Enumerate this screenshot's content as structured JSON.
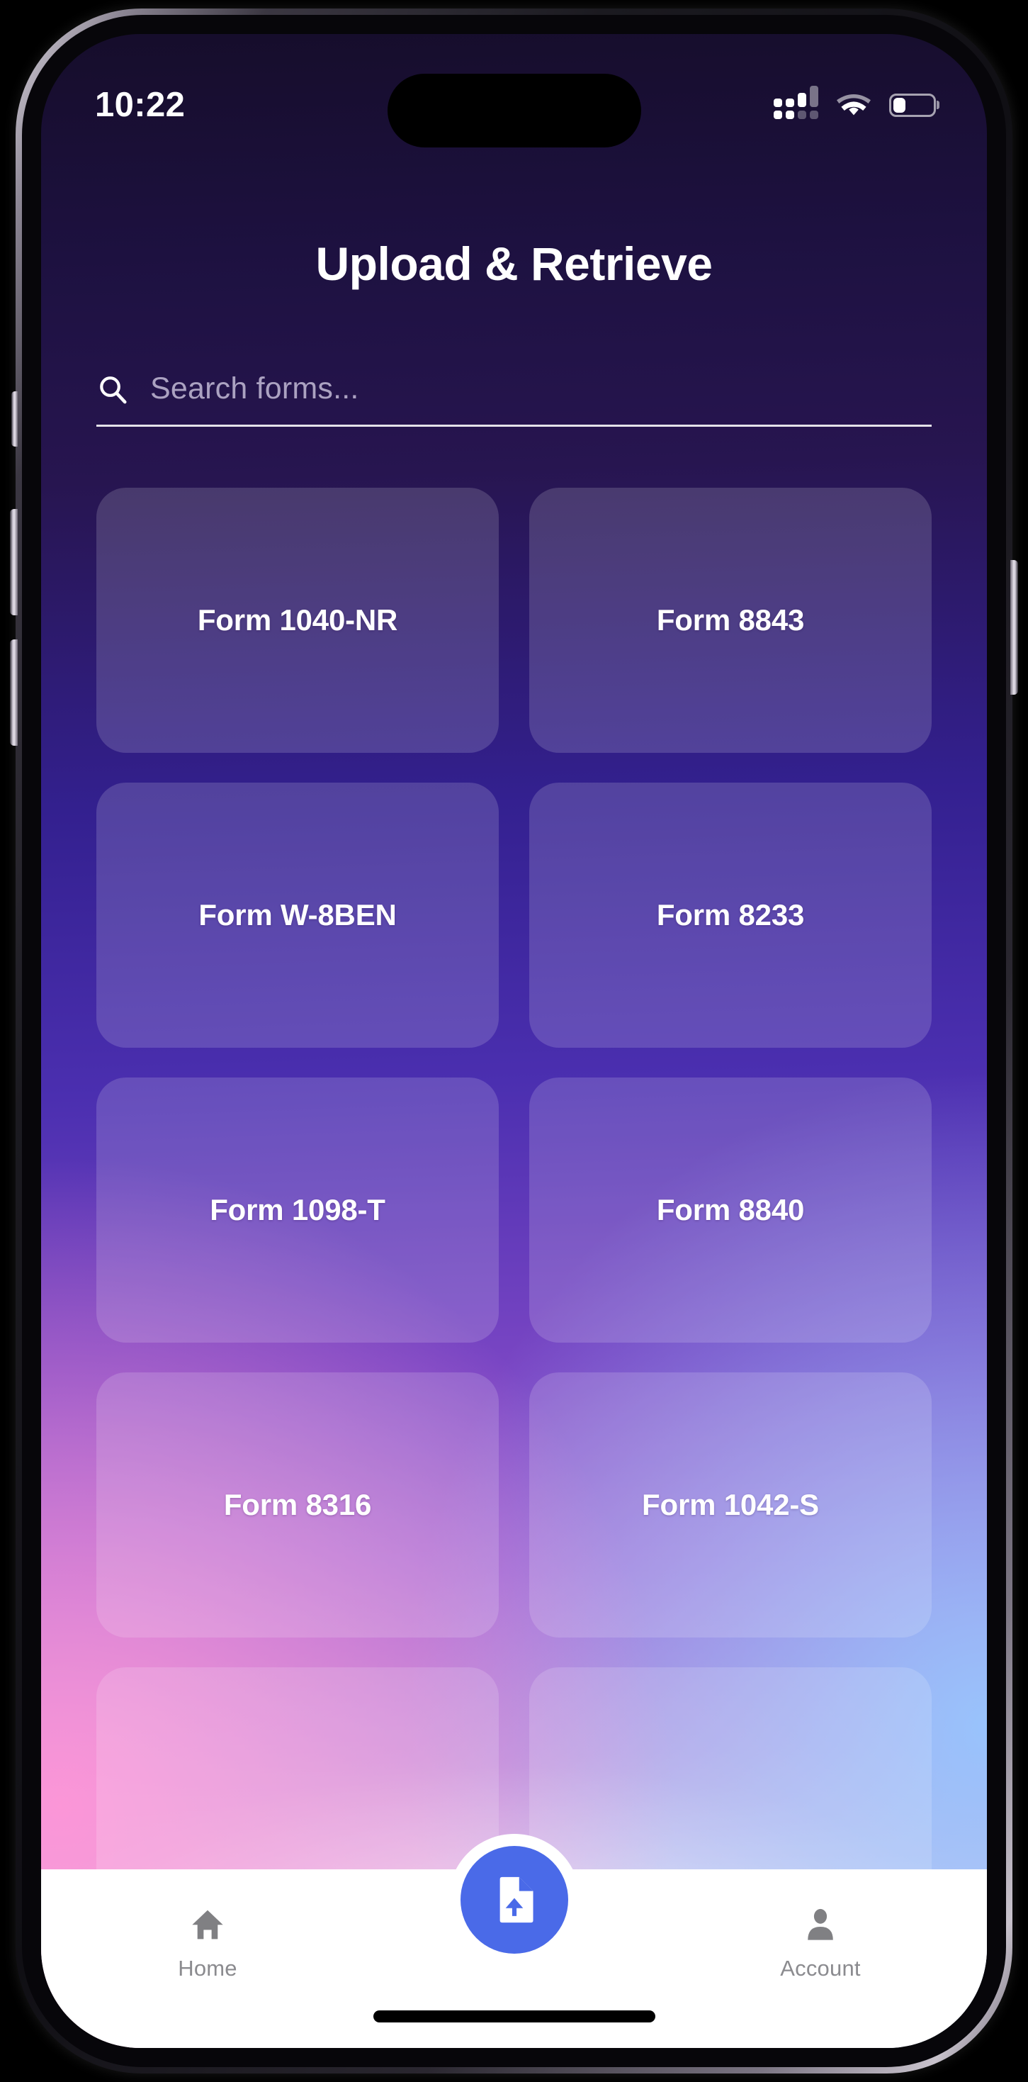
{
  "status_bar": {
    "time": "10:22",
    "cellular_icon": "cellular-signal-icon",
    "wifi_icon": "wifi-icon",
    "battery_icon": "battery-icon",
    "battery_level_percent": 32
  },
  "header": {
    "title": "Upload & Retrieve"
  },
  "search": {
    "icon": "search-icon",
    "placeholder": "Search forms...",
    "value": ""
  },
  "forms": {
    "cards": [
      {
        "label": "Form 1040-NR"
      },
      {
        "label": "Form 8843"
      },
      {
        "label": "Form W-8BEN"
      },
      {
        "label": "Form 8233"
      },
      {
        "label": "Form 1098-T"
      },
      {
        "label": "Form 8840"
      },
      {
        "label": "Form 8316"
      },
      {
        "label": "Form 1042-S"
      }
    ]
  },
  "bottom_nav": {
    "items": [
      {
        "label": "Home",
        "icon": "home-icon"
      },
      {
        "label": "Account",
        "icon": "person-icon"
      }
    ],
    "fab": {
      "icon": "file-upload-icon",
      "color": "#4a6ae8"
    }
  },
  "colors": {
    "accent": "#4a6ae8",
    "nav_bar_background": "#ffffff",
    "nav_label": "#8b8b8f",
    "card_overlay": "rgba(255,255,255,0.155)",
    "background_top": "#160d2b",
    "background_mid": "#4b2fb0",
    "background_bottom": "#f0eaf8"
  }
}
